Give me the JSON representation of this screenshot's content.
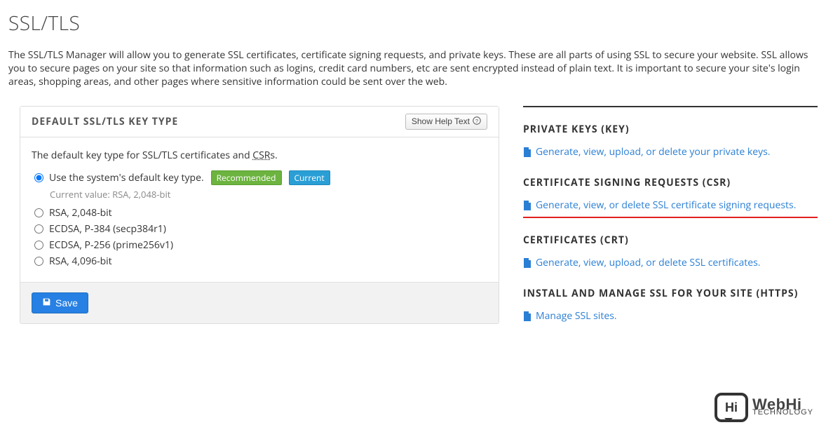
{
  "page_title": "SSL/TLS",
  "intro": "The SSL/TLS Manager will allow you to generate SSL certificates, certificate signing requests, and private keys. These are all parts of using SSL to secure your website. SSL allows you to secure pages on your site so that information such as logins, credit card numbers, etc are sent encrypted instead of plain text. It is important to secure your site's login areas, shopping areas, and other pages where sensitive information could be sent over the web.",
  "panel": {
    "title": "DEFAULT SSL/TLS KEY TYPE",
    "help_button": "Show Help Text",
    "description_pre": "The default key type for SSL/TLS certificates and ",
    "description_abbr": "CSR",
    "description_post": "s.",
    "options": [
      {
        "label": "Use the system's default key type.",
        "checked": true,
        "recommended": "Recommended",
        "current": "Current",
        "current_value": "Current value: RSA, 2,048-bit"
      },
      {
        "label": "RSA, 2,048-bit"
      },
      {
        "label": "ECDSA, P-384 (secp384r1)"
      },
      {
        "label": "ECDSA, P-256 (prime256v1)"
      },
      {
        "label": "RSA, 4,096-bit"
      }
    ],
    "save_button": "Save"
  },
  "sidebar": [
    {
      "heading": "PRIVATE KEYS (KEY)",
      "link": "Generate, view, upload, or delete your private keys.",
      "highlight": false
    },
    {
      "heading": "CERTIFICATE SIGNING REQUESTS (CSR)",
      "link": "Generate, view, or delete SSL certificate signing requests.",
      "highlight": true
    },
    {
      "heading": "CERTIFICATES (CRT)",
      "link": "Generate, view, upload, or delete SSL certificates.",
      "highlight": false
    },
    {
      "heading": "INSTALL AND MANAGE SSL FOR YOUR SITE (HTTPS)",
      "link": "Manage SSL sites.",
      "highlight": false
    }
  ],
  "logo": {
    "bubble": "Hi",
    "main": "WebHi",
    "sub": "TECHNOLOGY"
  }
}
